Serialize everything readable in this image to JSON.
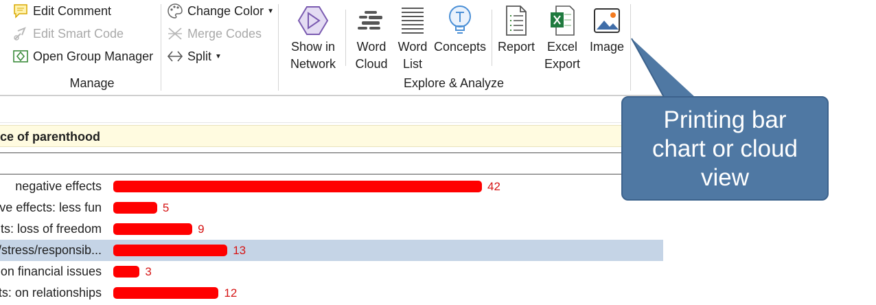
{
  "ribbon": {
    "manage": {
      "group_label": "Manage",
      "edit_comment": "Edit Comment",
      "edit_smart_code": "Edit Smart Code",
      "open_group_manager": "Open Group Manager",
      "change_color": "Change Color",
      "merge_codes": "Merge Codes",
      "split": "Split"
    },
    "explore": {
      "group_label": "Explore & Analyze",
      "show_network": [
        "Show in",
        "Network"
      ],
      "word_cloud": [
        "Word",
        "Cloud"
      ],
      "word_list": [
        "Word",
        "List"
      ],
      "concepts": "Concepts",
      "report": "Report",
      "excel_export": [
        "Excel",
        "Export"
      ],
      "image": "Image"
    }
  },
  "chart_title": "ce of parenthood",
  "chart_data": {
    "type": "bar",
    "categories": [
      "negative effects",
      "ive effects: less fun",
      "ts: loss of freedom",
      "/stress/responsib...",
      "on financial issues",
      "ts: on relationships"
    ],
    "values": [
      42,
      5,
      9,
      13,
      3,
      12
    ],
    "selected_index": 3,
    "bar_color": "#ff0000",
    "value_label_color": "#d61515"
  },
  "callout": {
    "lines": [
      "Printing bar",
      "chart or cloud",
      "view"
    ]
  },
  "colors": {
    "selection": "#c5d4e6",
    "title_bar": "#fffbe0",
    "callout": "#4f78a3"
  }
}
